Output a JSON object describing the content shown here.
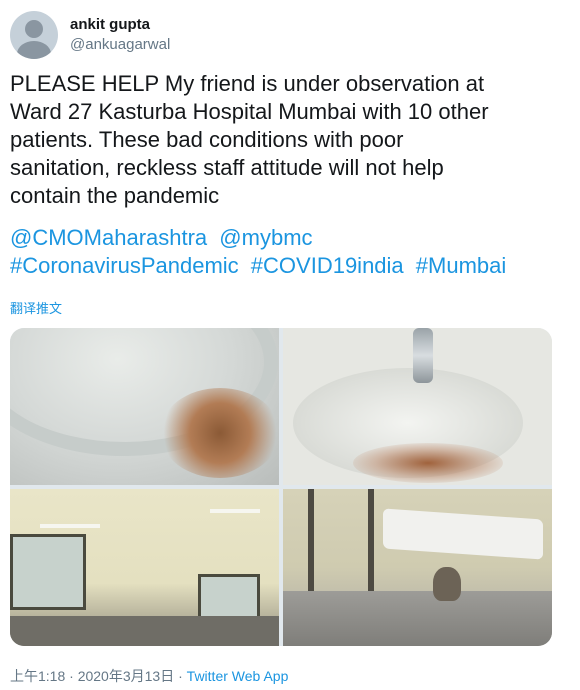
{
  "user": {
    "display_name": "ankit gupta",
    "handle": "@ankuagarwal"
  },
  "tweet": {
    "text": "PLEASE HELP My friend is under observation at\nWard 27 Kasturba Hospital Mumbai with 10 other\npatients. These bad conditions with poor\nsanitation, reckless staff attitude will not help\ncontain the pandemic",
    "mentions": [
      "@CMOMaharashtra",
      "@mybmc"
    ],
    "hashtags": [
      "#CoronavirusPandemic",
      "#COVID19india",
      "#Mumbai"
    ],
    "translate_label": "翻译推文"
  },
  "media": {
    "photos": [
      "sink-close-up",
      "sink-with-tap",
      "hospital-ward",
      "bed-with-cat"
    ]
  },
  "footer": {
    "time": "上午1:18",
    "separator": "·",
    "date": "2020年3月13日",
    "app": "Twitter Web App"
  },
  "colors": {
    "link": "#1b95e0",
    "text": "#14171a",
    "muted": "#657786"
  }
}
